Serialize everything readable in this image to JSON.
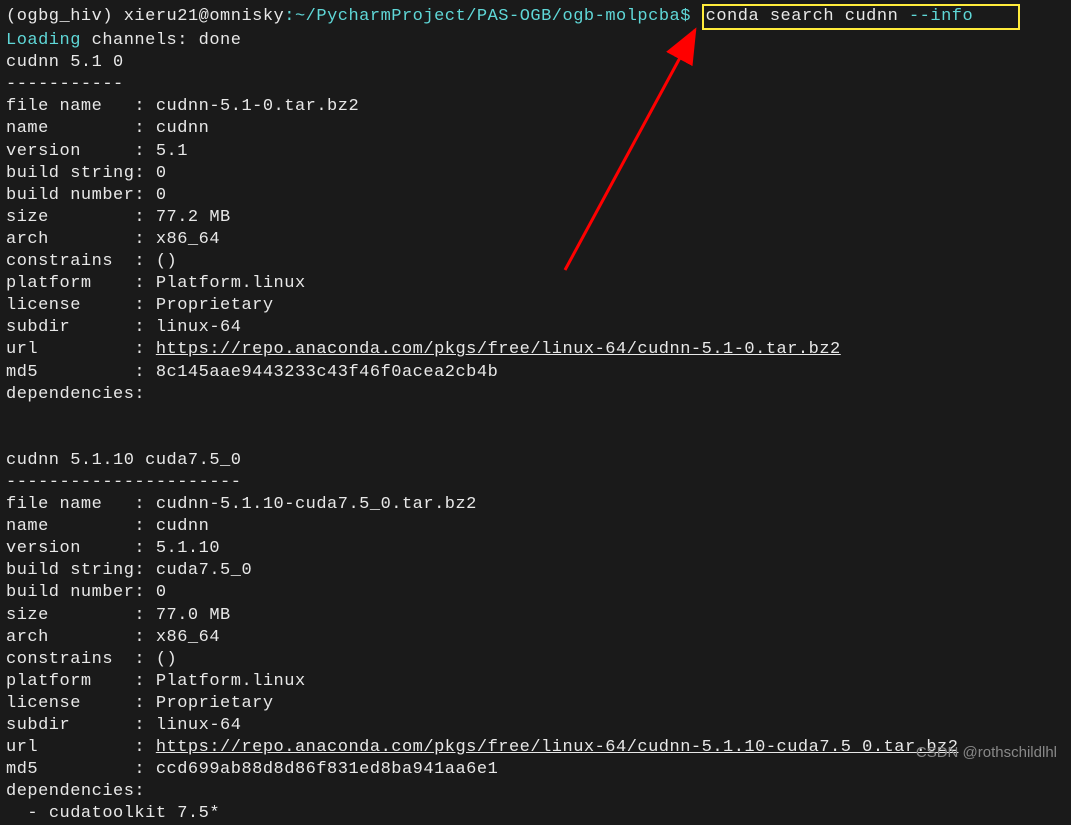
{
  "prompt": {
    "env": "(ogbg_hiv)",
    "user_host": "xieru21@omnisky",
    "path": ":~/PycharmProject/PAS-OGB/ogb-molpcba$",
    "command_prefix": "conda search cudnn ",
    "command_flag": "--info"
  },
  "loading": {
    "prefix": "Loading",
    "rest": " channels: done"
  },
  "package1": {
    "header": "cudnn 5.1 0",
    "dashes": "-----------",
    "file_name": "cudnn-5.1-0.tar.bz2",
    "name": "cudnn",
    "version": "5.1",
    "build_string": "0",
    "build_number": "0",
    "size": "77.2 MB",
    "arch": "x86_64",
    "constrains": "()",
    "platform": "Platform.linux",
    "license": "Proprietary",
    "subdir": "linux-64",
    "url": "https://repo.anaconda.com/pkgs/free/linux-64/cudnn-5.1-0.tar.bz2",
    "md5": "8c145aae9443233c43f46f0acea2cb4b",
    "dependencies": ""
  },
  "package2": {
    "header": "cudnn 5.1.10 cuda7.5_0",
    "dashes": "----------------------",
    "file_name": "cudnn-5.1.10-cuda7.5_0.tar.bz2",
    "name": "cudnn",
    "version": "5.1.10",
    "build_string": "cuda7.5_0",
    "build_number": "0",
    "size": "77.0 MB",
    "arch": "x86_64",
    "constrains": "()",
    "platform": "Platform.linux",
    "license": "Proprietary",
    "subdir": "linux-64",
    "url": "https://repo.anaconda.com/pkgs/free/linux-64/cudnn-5.1.10-cuda7.5_0.tar.bz2",
    "md5": "ccd699ab88d8d86f831ed8ba941aa6e1",
    "dep1": "cudatoolkit 7.5*"
  },
  "labels": {
    "file_name": "file name   : ",
    "name": "name        : ",
    "version": "version     : ",
    "build_string": "build string: ",
    "build_number": "build number: ",
    "size": "size        : ",
    "arch": "arch        : ",
    "constrains": "constrains  : ",
    "platform": "platform    : ",
    "license": "license     : ",
    "subdir": "subdir      : ",
    "url": "url         : ",
    "md5": "md5         : ",
    "dependencies": "dependencies: ",
    "dep_prefix": "  - "
  },
  "watermark": "CSDN @rothschildlhl"
}
